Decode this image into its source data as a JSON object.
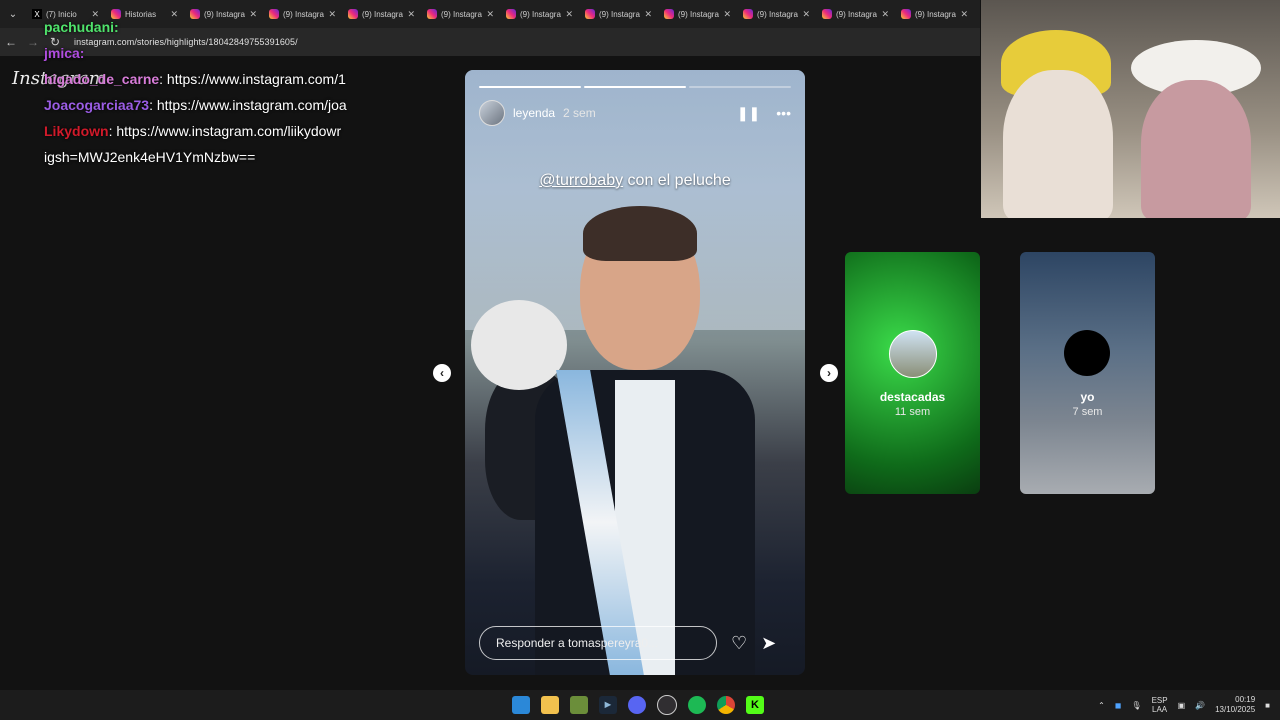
{
  "browser": {
    "tabs": [
      {
        "label": "(7) Inicio",
        "icon": "x-icon"
      },
      {
        "label": "Historias",
        "icon": "instagram-icon"
      },
      {
        "label": "(9) Instagram",
        "icon": "instagram-icon"
      },
      {
        "label": "(9) Instagram",
        "icon": "instagram-icon"
      },
      {
        "label": "(9) Instagram",
        "icon": "instagram-icon"
      },
      {
        "label": "(9) Instagram",
        "icon": "instagram-icon"
      },
      {
        "label": "(9) Instagram",
        "icon": "instagram-icon"
      },
      {
        "label": "(9) Instagram",
        "icon": "instagram-icon"
      },
      {
        "label": "(9) Instagram",
        "icon": "instagram-icon"
      },
      {
        "label": "(9) Instagram",
        "icon": "instagram-icon"
      },
      {
        "label": "(9) Instagram",
        "icon": "instagram-icon"
      },
      {
        "label": "(9) Instagram",
        "icon": "instagram-icon"
      }
    ],
    "url": "instagram.com/stories/highlights/18042849755391605/"
  },
  "chat": {
    "messages": [
      {
        "user": "pachudani:",
        "text": "",
        "color": "#4fe36b"
      },
      {
        "user": "jmica:",
        "text": "",
        "color": "#b04de0"
      },
      {
        "user": "higado_de_carne",
        "text": ": https://www.instagram.com/1",
        "color": "#d77cd8"
      },
      {
        "user": "Joacogarciaa73",
        "text": ": https://www.instagram.com/joa",
        "color": "#9b5de5"
      },
      {
        "user": "Likydown",
        "text": ": https://www.instagram.com/liikydowr",
        "color": "#d11a2a"
      },
      {
        "user": "",
        "text": "igsh=MWJ2enk4eHV1YmNzbw==",
        "color": "#ffffff"
      }
    ],
    "brand_word": "Instagram"
  },
  "story": {
    "username": "leyenda",
    "time": "2 sem",
    "caption_mention": "@turrobaby",
    "caption_rest": " con el peluche",
    "reply_placeholder": "Responder a tomaspereyra0...",
    "progress_segments": 3,
    "progress_done": 2
  },
  "highlights": [
    {
      "title": "destacadas",
      "subtitle": "11 sem"
    },
    {
      "title": "yo",
      "subtitle": "7 sem"
    }
  ],
  "taskbar": {
    "lang_top": "ESP",
    "lang_bottom": "LAA",
    "time": "00:19",
    "date": "13/10/2025"
  }
}
